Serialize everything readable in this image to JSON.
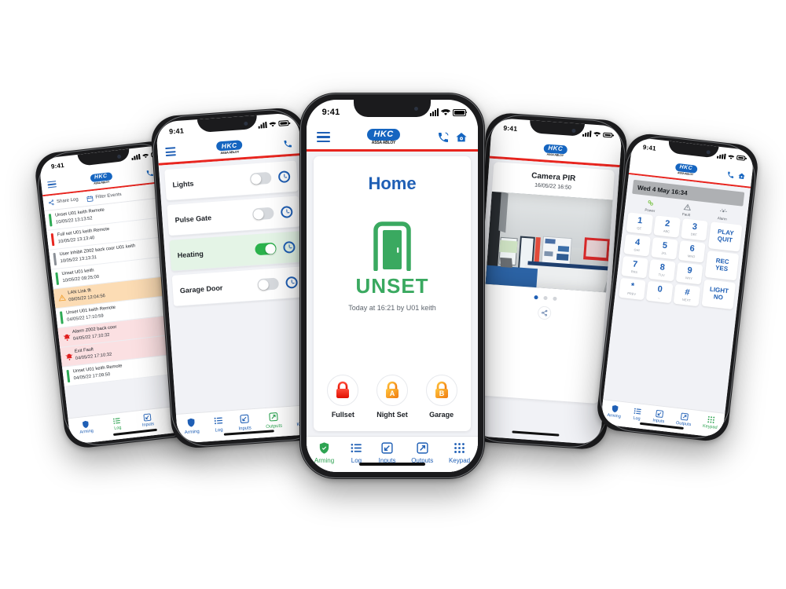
{
  "status_bar": {
    "time": "9:41"
  },
  "brand": {
    "mark": "HKC",
    "sub": "ASSA ABLOY"
  },
  "colors": {
    "brand_blue": "#1565c0",
    "accent_red": "#e8251f",
    "active_green": "#2ea352",
    "warn_amber": "#fcdcb4",
    "alarm_pink": "#fbe0e2"
  },
  "tabs": [
    {
      "label": "Arming",
      "icon": "shield-icon"
    },
    {
      "label": "Log",
      "icon": "list-icon"
    },
    {
      "label": "Inputs",
      "icon": "arrow-in-icon"
    },
    {
      "label": "Outputs",
      "icon": "arrow-out-icon"
    },
    {
      "label": "Keypad",
      "icon": "grid-icon"
    }
  ],
  "phone_log": {
    "active_tab": "Log",
    "toolbar": [
      {
        "label": "Share Log",
        "icon": "share-icon"
      },
      {
        "label": "Filter Events",
        "icon": "calendar-icon"
      }
    ],
    "entries": [
      {
        "title": "Unset U01 keith Remote",
        "date": "10/05/22 13:13:52",
        "type": "ok"
      },
      {
        "title": "Full set U01 keith Remote",
        "date": "10/05/22 13:13:40",
        "type": "set"
      },
      {
        "title": "User Inhibit Z002 back coor U01 keith",
        "date": "10/05/22 13:13:31",
        "type": "info"
      },
      {
        "title": "Unset U01 keith",
        "date": "10/05/22 09:25:00",
        "type": "ok"
      },
      {
        "title": "LAN Link flt",
        "date": "09/05/22 12:04:56",
        "type": "warn"
      },
      {
        "title": "Unset U01 keith Remote",
        "date": "04/05/22 17:10:59",
        "type": "ok"
      },
      {
        "title": "Alarm Z002 back coor",
        "date": "04/05/22 17:10:32",
        "type": "alarm"
      },
      {
        "title": "Exit Fault",
        "date": "04/05/22 17:10:32",
        "type": "alarm"
      },
      {
        "title": "Unset U01 keith Remote",
        "date": "04/05/22 17:09:50",
        "type": "ok"
      }
    ]
  },
  "phone_outputs": {
    "active_tab": "Outputs",
    "rows": [
      {
        "name": "Lights",
        "on": false
      },
      {
        "name": "Pulse Gate",
        "on": false
      },
      {
        "name": "Heating",
        "on": true
      },
      {
        "name": "Garage Door",
        "on": false
      }
    ]
  },
  "phone_home": {
    "active_tab": "Arming",
    "title": "Home",
    "state": "UNSET",
    "state_icon": "door-open-icon",
    "state_sub": "Today at 16:21 by U01 keith",
    "actions": [
      {
        "label": "Fullset",
        "icon": "lock-red-icon",
        "color": "#ef2a1e"
      },
      {
        "label": "Night Set",
        "icon": "lock-a-icon",
        "color": "#f5a623"
      },
      {
        "label": "Garage",
        "icon": "lock-b-icon",
        "color": "#f5a623"
      }
    ]
  },
  "phone_camera": {
    "title": "Camera PIR",
    "date": "16/05/22 16:50",
    "share_icon": "share-icon",
    "page_dots": 3,
    "active_dot": 0
  },
  "phone_keypad": {
    "active_tab": "Keypad",
    "display": "Wed  4 May 16:34",
    "indicators": [
      {
        "label": "Power",
        "icon": "power-icon"
      },
      {
        "label": "Fault",
        "icon": "warning-icon"
      },
      {
        "label": "Alarm",
        "icon": "bell-icon"
      }
    ],
    "keys": [
      {
        "num": "1",
        "sub": "QZ"
      },
      {
        "num": "2",
        "sub": "ABC"
      },
      {
        "num": "3",
        "sub": "DEF"
      },
      {
        "num": "4",
        "sub": "GHI"
      },
      {
        "num": "5",
        "sub": "JKL"
      },
      {
        "num": "6",
        "sub": "MNO"
      },
      {
        "num": "7",
        "sub": "PRS"
      },
      {
        "num": "8",
        "sub": "TUV"
      },
      {
        "num": "9",
        "sub": "WXY"
      },
      {
        "num": "*",
        "sub": "PREV"
      },
      {
        "num": "0",
        "sub": "_"
      },
      {
        "num": "#",
        "sub": "NEXT"
      }
    ],
    "functions": [
      {
        "line1": "PLAY",
        "line2": "QUIT"
      },
      {
        "line1": "REC",
        "line2": "YES"
      },
      {
        "line1": "LIGHT",
        "line2": "NO"
      }
    ]
  }
}
